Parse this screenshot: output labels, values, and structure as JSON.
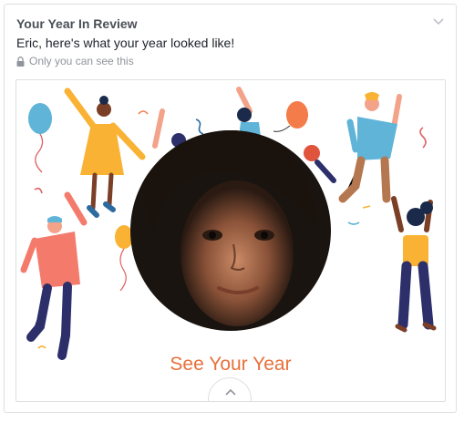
{
  "post": {
    "title": "Your Year In Review",
    "subtitle": "Eric, here's what your year looked like!",
    "privacy_label": "Only you can see this"
  },
  "media": {
    "cta_label": "See Your Year",
    "accent_color": "#e8703a"
  },
  "icons": {
    "menu": "chevron-down-icon",
    "privacy": "lock-icon",
    "expand": "chevron-up-icon"
  }
}
